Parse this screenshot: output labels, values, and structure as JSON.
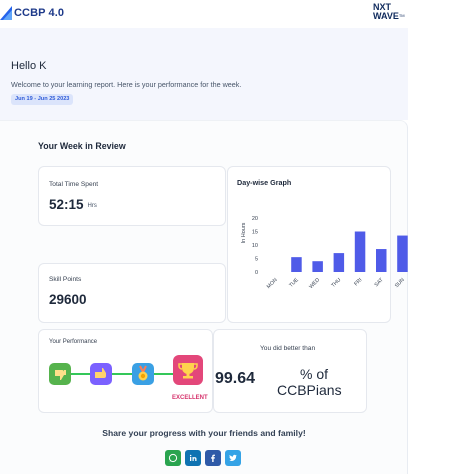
{
  "header": {
    "brand_left": "CCBP 4.0",
    "brand_right_line1": "NXT",
    "brand_right_line2": "WAVE",
    "brand_right_tm": "TM"
  },
  "hero": {
    "greeting": "Hello K",
    "welcome": "Welcome to your learning report. Here is your performance for the week.",
    "date_range": "Jun 19 - Jun 25 2023"
  },
  "week_review": {
    "title": "Your Week in Review",
    "time_spent": {
      "label": "Total Time Spent",
      "value": "52:15",
      "unit": "Hrs"
    },
    "skill_points": {
      "label": "Skill Points",
      "value": "29600"
    },
    "graph_title": "Day-wise Graph",
    "performance": {
      "title": "Your Performance",
      "level_label": "EXCELLENT",
      "badge_icons": [
        "thumbs-down-icon",
        "thumbs-up-icon",
        "medal-icon",
        "trophy-icon"
      ]
    },
    "comparison": {
      "label": "You did better than",
      "value": "99.64",
      "percent": "% of",
      "unit": "CCBPians"
    }
  },
  "share": {
    "text": "Share your progress with your friends and family!",
    "buttons": [
      "whatsapp-icon",
      "linkedin-icon",
      "facebook-icon",
      "twitter-icon"
    ]
  },
  "chart_data": {
    "type": "bar",
    "title": "Day-wise Graph",
    "xlabel": "",
    "ylabel": "In Hours",
    "categories": [
      "MON",
      "TUE",
      "WED",
      "THU",
      "FRI",
      "SAT",
      "SUN"
    ],
    "values": [
      0,
      5.5,
      4,
      7,
      15,
      8.5,
      13.5
    ],
    "ylim": [
      0,
      20
    ],
    "yticks": [
      0,
      5,
      10,
      15,
      20
    ],
    "grid": false,
    "color": "#4f5be8"
  }
}
